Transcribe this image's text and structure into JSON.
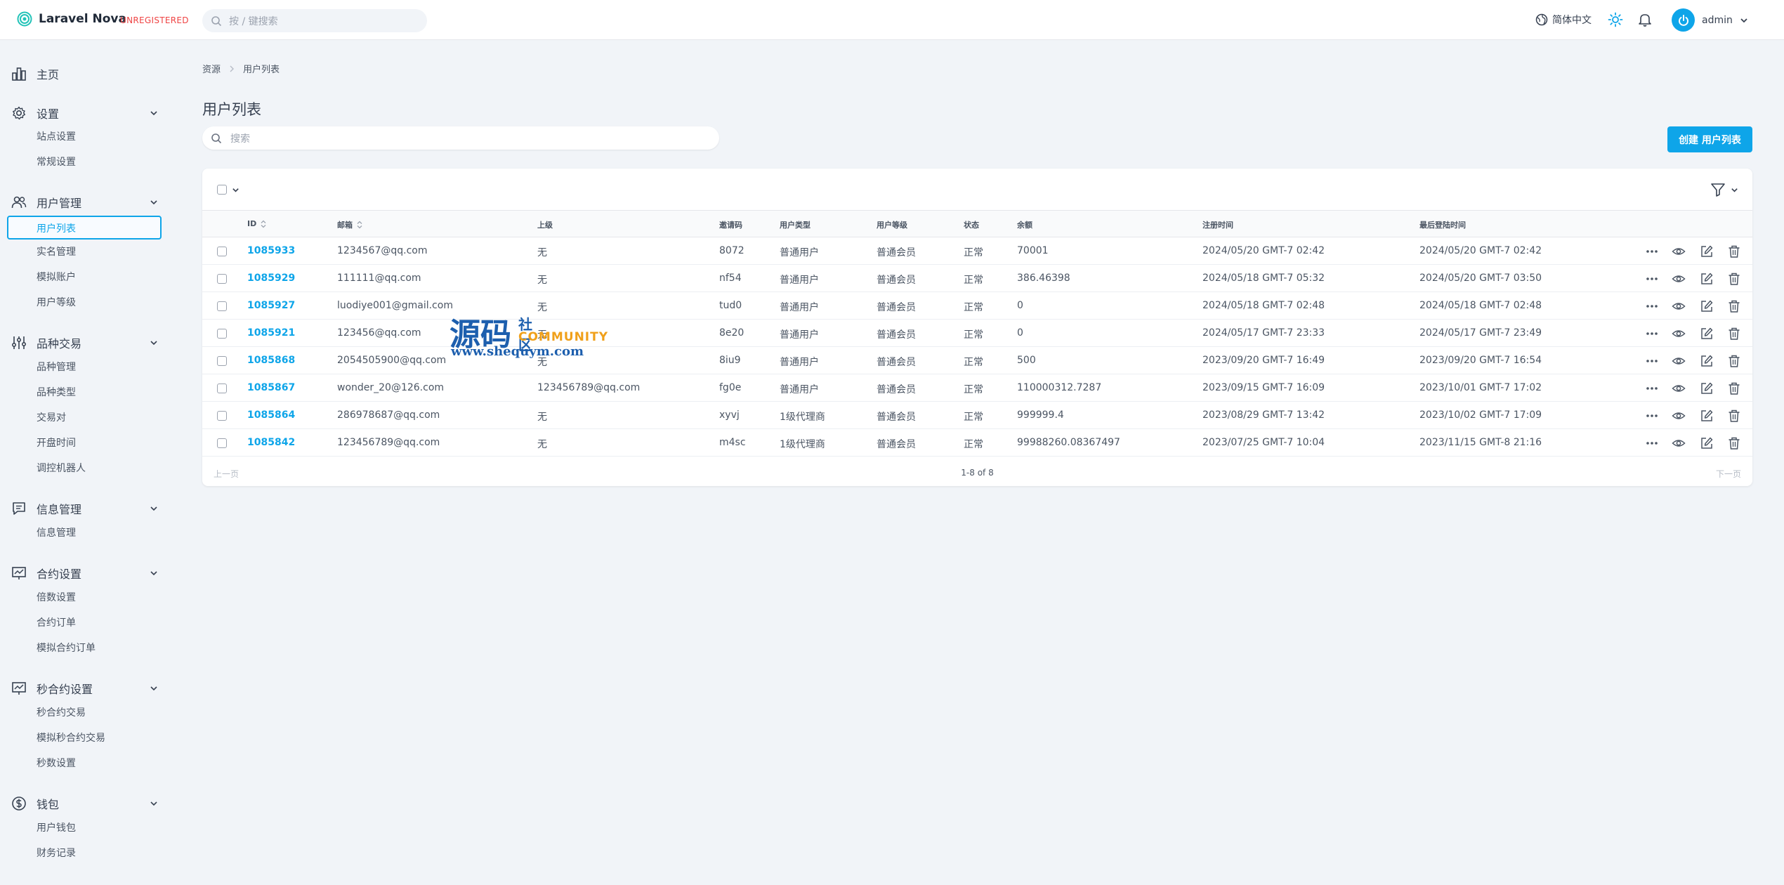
{
  "app": {
    "name": "Laravel Nova",
    "badge": "UNREGISTERED"
  },
  "global_search": {
    "placeholder": "按 / 键搜索"
  },
  "header": {
    "language": "简体中文",
    "user": "admin"
  },
  "sidebar": {
    "home": "主页",
    "groups": [
      {
        "label": "设置",
        "items": [
          "站点设置",
          "常规设置"
        ]
      },
      {
        "label": "用户管理",
        "items": [
          "用户列表",
          "实名管理",
          "模拟账户",
          "用户等级"
        ]
      },
      {
        "label": "品种交易",
        "items": [
          "品种管理",
          "品种类型",
          "交易对",
          "开盘时间",
          "调控机器人"
        ]
      },
      {
        "label": "信息管理",
        "items": [
          "信息管理"
        ]
      },
      {
        "label": "合约设置",
        "items": [
          "倍数设置",
          "合约订单",
          "模拟合约订单"
        ]
      },
      {
        "label": "秒合约设置",
        "items": [
          "秒合约交易",
          "模拟秒合约交易",
          "秒数设置"
        ]
      },
      {
        "label": "钱包",
        "items": [
          "用户钱包",
          "财务记录"
        ]
      }
    ],
    "active_item": "用户列表"
  },
  "breadcrumb": [
    "资源",
    "用户列表"
  ],
  "page": {
    "title": "用户列表",
    "search_placeholder": "搜索",
    "create_button": "创建 用户列表"
  },
  "table": {
    "columns": [
      "ID",
      "邮箱",
      "上级",
      "邀请码",
      "用户类型",
      "用户等级",
      "状态",
      "余额",
      "注册时间",
      "最后登陆时间"
    ],
    "rows": [
      [
        "1085933",
        "1234567@qq.com",
        "无",
        "8072",
        "普通用户",
        "普通会员",
        "正常",
        "70001",
        "2024/05/20 GMT-7 02:42",
        "2024/05/20 GMT-7 02:42"
      ],
      [
        "1085929",
        "111111@qq.com",
        "无",
        "nf54",
        "普通用户",
        "普通会员",
        "正常",
        "386.46398",
        "2024/05/18 GMT-7 05:32",
        "2024/05/20 GMT-7 03:50"
      ],
      [
        "1085927",
        "luodiye001@gmail.com",
        "无",
        "tud0",
        "普通用户",
        "普通会员",
        "正常",
        "0",
        "2024/05/18 GMT-7 02:48",
        "2024/05/18 GMT-7 02:48"
      ],
      [
        "1085921",
        "123456@qq.com",
        "无",
        "8e20",
        "普通用户",
        "普通会员",
        "正常",
        "0",
        "2024/05/17 GMT-7 23:33",
        "2024/05/17 GMT-7 23:49"
      ],
      [
        "1085868",
        "2054505900@qq.com",
        "无",
        "8iu9",
        "普通用户",
        "普通会员",
        "正常",
        "500",
        "2023/09/20 GMT-7 16:49",
        "2023/09/20 GMT-7 16:54"
      ],
      [
        "1085867",
        "wonder_20@126.com",
        "123456789@qq.com",
        "fg0e",
        "普通用户",
        "普通会员",
        "正常",
        "110000312.7287",
        "2023/09/15 GMT-7 16:09",
        "2023/10/01 GMT-7 17:02"
      ],
      [
        "1085864",
        "286978687@qq.com",
        "无",
        "xyvj",
        "1级代理商",
        "普通会员",
        "正常",
        "999999.4",
        "2023/08/29 GMT-7 13:42",
        "2023/10/02 GMT-7 17:09"
      ],
      [
        "1085842",
        "123456789@qq.com",
        "无",
        "m4sc",
        "1级代理商",
        "普通会员",
        "正常",
        "99988260.08367497",
        "2023/07/25 GMT-7 10:04",
        "2023/11/15 GMT-8 21:16"
      ]
    ]
  },
  "pagination": {
    "prev": "上一页",
    "info": "1-8 of 8",
    "next": "下一页"
  },
  "watermark": {
    "big": "源码",
    "small": "社区",
    "community": "COMMUNITY",
    "url": "www.shequym.com"
  },
  "colors": {
    "accent": "#0ea5e9",
    "danger": "#ef4444"
  }
}
